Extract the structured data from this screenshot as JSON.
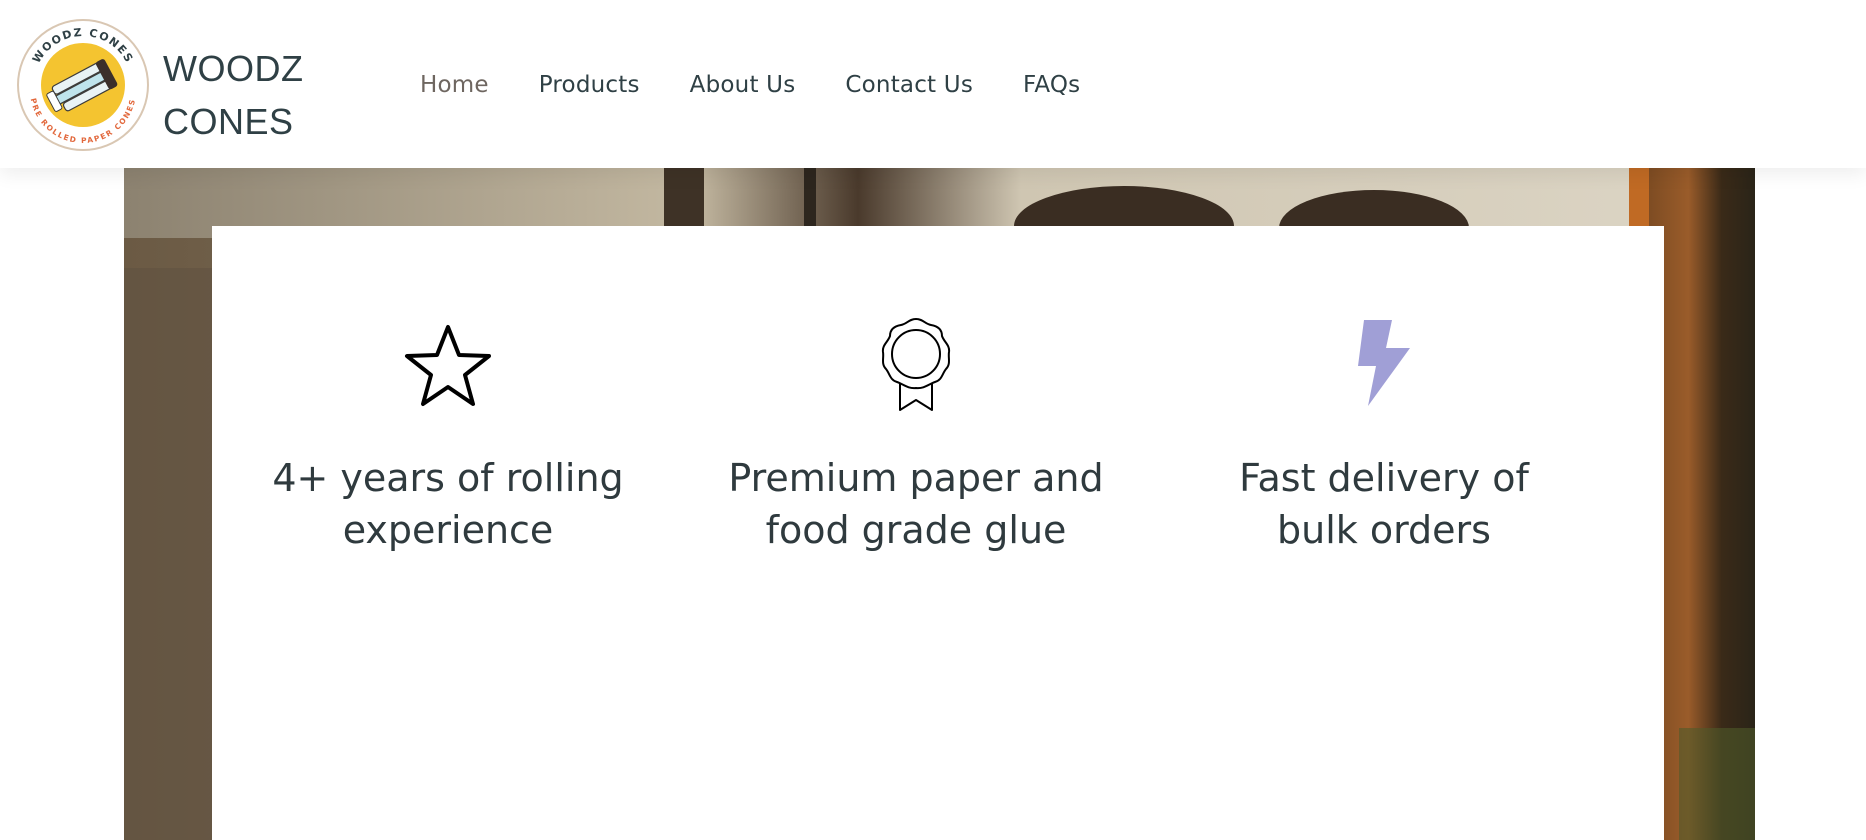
{
  "brand": {
    "line1": "WOODZ",
    "line2": "CONES",
    "badge_top_text": "WOODZ CONES",
    "badge_bottom_text": "PRE ROLLED PAPER CONES"
  },
  "nav": {
    "items": [
      {
        "label": "Home",
        "active": true
      },
      {
        "label": "Products",
        "active": false
      },
      {
        "label": "About Us",
        "active": false
      },
      {
        "label": "Contact Us",
        "active": false
      },
      {
        "label": "FAQs",
        "active": false
      }
    ]
  },
  "features": [
    {
      "icon": "star-icon",
      "text": "4+ years of rolling experience"
    },
    {
      "icon": "award-ribbon-icon",
      "text": "Premium paper and food grade glue"
    },
    {
      "icon": "lightning-bolt-icon",
      "text": "Fast delivery of bulk orders"
    }
  ],
  "colors": {
    "text_dark": "#2f4045",
    "nav_active": "#6e6660",
    "bolt_accent": "#a09fd6",
    "badge_yellow": "#f4c430"
  }
}
